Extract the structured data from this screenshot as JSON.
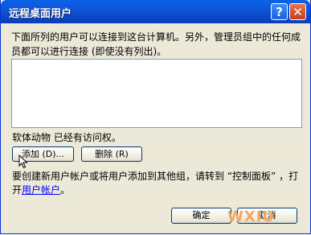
{
  "dialog": {
    "title": "远程桌面用户",
    "help_label": "?",
    "close_label": "✕",
    "description": "下面所列的用户可以连接到这台计算机。另外，管理员组中的任何成员都可以进行连接 (即使没有列出)。",
    "users": [],
    "status_text": "软体动物 已经有访问权。",
    "add_button": "添加 (D)...",
    "remove_button": "删除 (R)",
    "footer_text": "要创建新用户帐户或将用户添加到其他组，请转到 “控制面板” ，打开",
    "footer_link": "用户帐户",
    "footer_end": "。",
    "ok_button": "确定",
    "cancel_button": "取消"
  },
  "watermark": "WXIU",
  "colors": {
    "title_bar": "#0a52d6",
    "dialog_bg": "#ece9d8",
    "link": "#0000ff"
  }
}
